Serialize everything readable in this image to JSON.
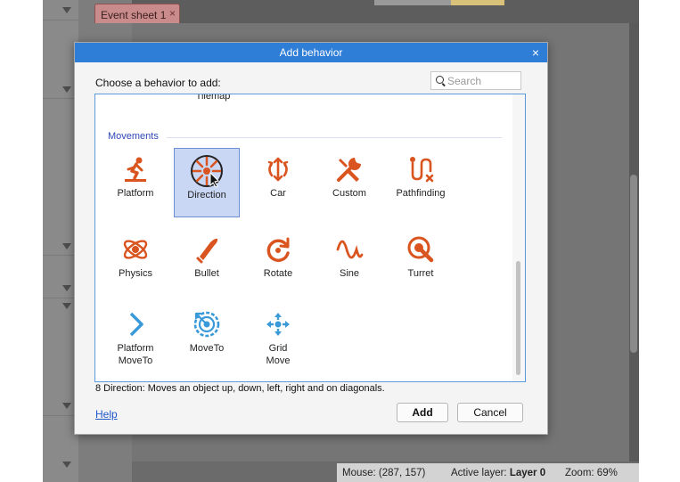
{
  "editor": {
    "tab_label": "Event sheet 1",
    "tab_close": "×",
    "status": {
      "mouse_label": "Mouse:",
      "mouse_value": "(287, 157)",
      "layer_label": "Active layer:",
      "layer_value": "Layer 0",
      "zoom_label": "Zoom:",
      "zoom_value": "69%"
    }
  },
  "dialog": {
    "title": "Add behavior",
    "close": "×",
    "prompt": "Choose a behavior to add:",
    "search_placeholder": "Search",
    "partial_item_label": "Tilemap",
    "category": "Movements",
    "items": [
      {
        "label": "Platform",
        "icon": "platform-icon",
        "selected": false
      },
      {
        "label": "Direction",
        "icon": "direction-icon",
        "selected": true
      },
      {
        "label": "Car",
        "icon": "car-icon",
        "selected": false
      },
      {
        "label": "Custom",
        "icon": "wrench-icon",
        "selected": false
      },
      {
        "label": "Pathfinding",
        "icon": "pathfinding-icon",
        "selected": false
      },
      {
        "label": "Physics",
        "icon": "physics-icon",
        "selected": false
      },
      {
        "label": "Bullet",
        "icon": "bullet-icon",
        "selected": false
      },
      {
        "label": "Rotate",
        "icon": "rotate-icon",
        "selected": false
      },
      {
        "label": "Sine",
        "icon": "sine-icon",
        "selected": false
      },
      {
        "label": "Turret",
        "icon": "turret-icon",
        "selected": false
      },
      {
        "label": "Platform\nMoveTo",
        "icon": "chevron-right-icon",
        "selected": false
      },
      {
        "label": "MoveTo",
        "icon": "target-icon",
        "selected": false
      },
      {
        "label": "Grid\nMove",
        "icon": "grid-move-icon",
        "selected": false
      }
    ],
    "description": "8 Direction: Moves an object up, down, left, right and on diagonals.",
    "help_label": "Help",
    "add_label": "Add",
    "cancel_label": "Cancel"
  },
  "colors": {
    "accent": "#2e7dd7",
    "icon_orange": "#d9541e",
    "icon_blue": "#3a9ad9",
    "category_blue": "#2f48b8"
  }
}
